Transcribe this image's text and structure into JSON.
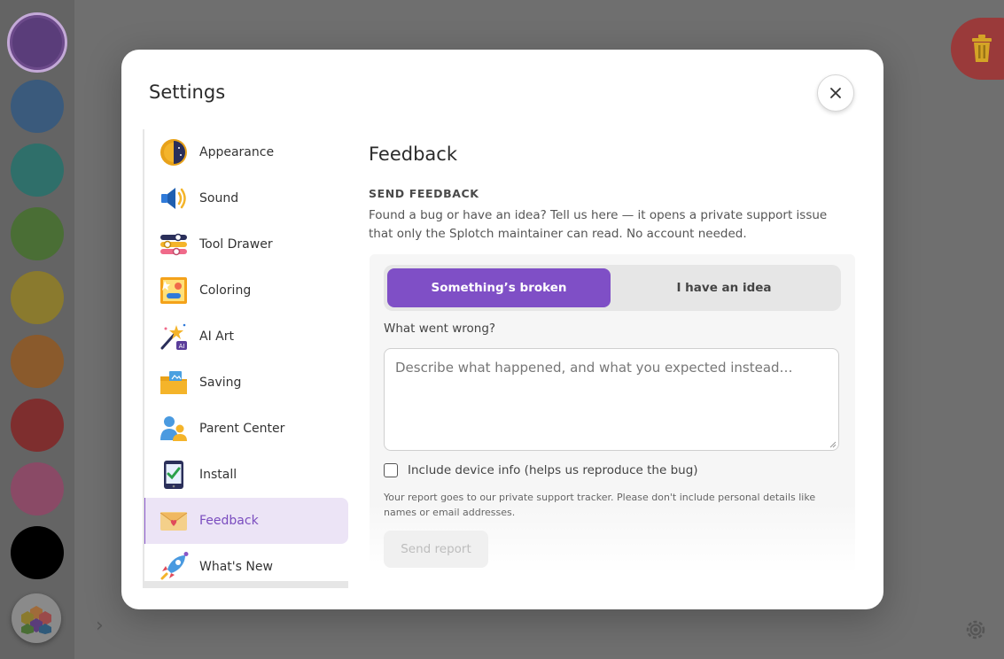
{
  "palette": {
    "colors": [
      "#5a3d7a",
      "#3a5a7c",
      "#2f6f6a",
      "#4a6e35",
      "#8a7a2e",
      "#8a5a2c",
      "#7e2e2e",
      "#8a4a66",
      "#000000"
    ],
    "selected_index": 0
  },
  "settings": {
    "title": "Settings",
    "nav_items": [
      {
        "label": "Appearance",
        "icon": "sun-moon-icon"
      },
      {
        "label": "Sound",
        "icon": "speaker-icon"
      },
      {
        "label": "Tool Drawer",
        "icon": "sliders-icon"
      },
      {
        "label": "Coloring",
        "icon": "coloring-page-icon"
      },
      {
        "label": "AI Art",
        "icon": "magic-wand-icon"
      },
      {
        "label": "Saving",
        "icon": "folder-icon"
      },
      {
        "label": "Parent Center",
        "icon": "parent-child-icon"
      },
      {
        "label": "Install",
        "icon": "phone-check-icon"
      },
      {
        "label": "Feedback",
        "icon": "envelope-heart-icon"
      },
      {
        "label": "What's New",
        "icon": "rocket-icon"
      }
    ],
    "active_item": "Feedback"
  },
  "feedback": {
    "title": "Feedback",
    "section_heading": "SEND FEEDBACK",
    "description": "Found a bug or have an idea? Tell us here — it opens a private support issue that only the Splotch maintainer can read. No account needed.",
    "segments": {
      "broken_label": "Something’s broken",
      "idea_label": "I have an idea",
      "selected": "Something’s broken"
    },
    "field_label": "What went wrong?",
    "textarea_placeholder": "Describe what happened, and what you expected instead…",
    "include_device_label": "Include device info (helps us reproduce the bug)",
    "include_device_checked": false,
    "privacy_note": "Your report goes to our private support tracker. Please don't include personal details like names or email addresses.",
    "send_label": "Send report"
  },
  "colors": {
    "accent": "#7f4fc6",
    "active_bg": "#ece4f6",
    "trash": "#e8b92a"
  }
}
